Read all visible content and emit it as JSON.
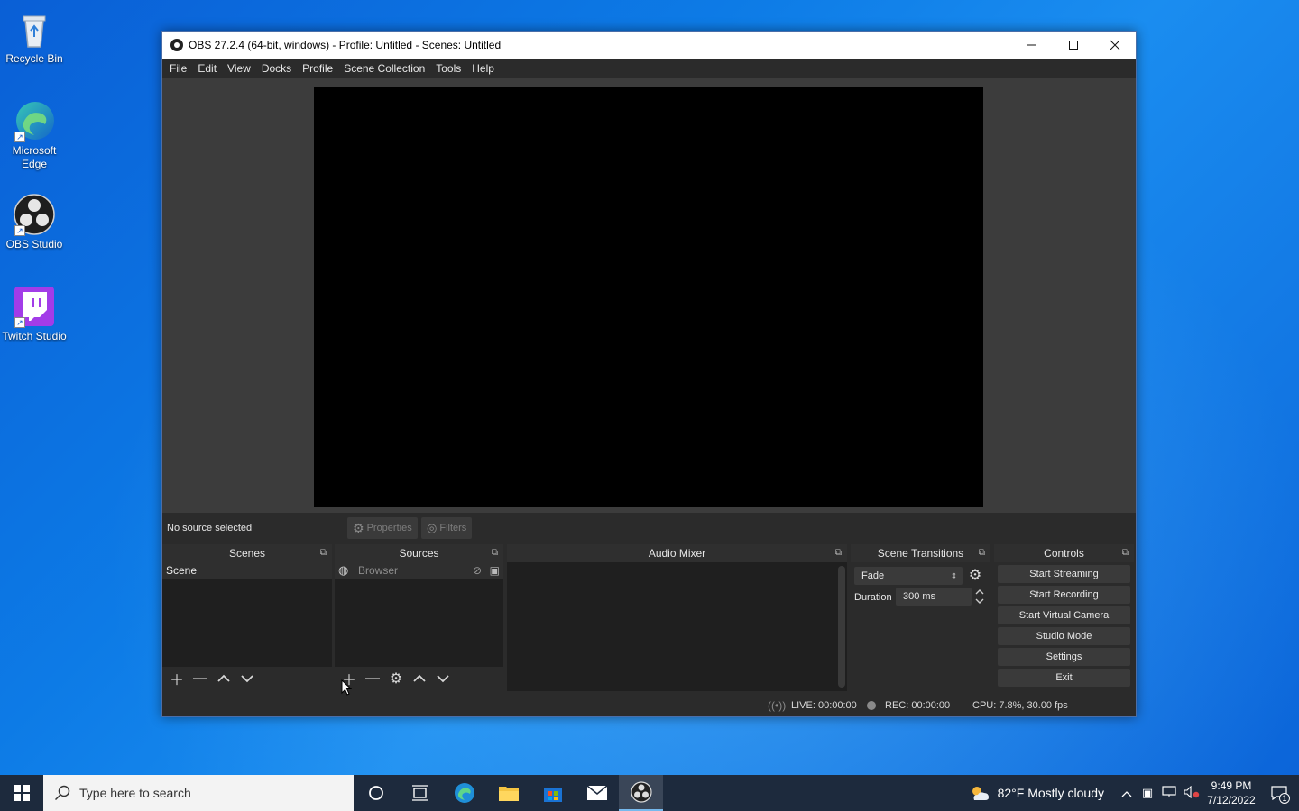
{
  "desktop": {
    "icons": [
      {
        "label": "Recycle Bin"
      },
      {
        "label": "Microsoft Edge"
      },
      {
        "label": "OBS Studio"
      },
      {
        "label": "Twitch Studio"
      }
    ]
  },
  "window": {
    "title": "OBS 27.2.4 (64-bit, windows) - Profile: Untitled - Scenes: Untitled",
    "minimize_icon": "minimize-icon",
    "maximize_icon": "maximize-icon",
    "close_icon": "close-icon"
  },
  "menu": {
    "items": [
      "File",
      "Edit",
      "View",
      "Docks",
      "Profile",
      "Scene Collection",
      "Tools",
      "Help"
    ]
  },
  "source_bar": {
    "no_source": "No source selected",
    "properties": "Properties",
    "filters": "Filters"
  },
  "docks": {
    "scenes": {
      "title": "Scenes",
      "items": [
        "Scene"
      ]
    },
    "sources": {
      "title": "Sources",
      "items": [
        "Browser"
      ]
    },
    "audio_mixer": {
      "title": "Audio Mixer"
    },
    "transitions": {
      "title": "Scene Transitions",
      "selected": "Fade",
      "duration_label": "Duration",
      "duration_value": "300 ms"
    },
    "controls": {
      "title": "Controls",
      "buttons": [
        "Start Streaming",
        "Start Recording",
        "Start Virtual Camera",
        "Studio Mode",
        "Settings",
        "Exit"
      ]
    }
  },
  "status": {
    "live": "LIVE: 00:00:00",
    "rec": "REC: 00:00:00",
    "cpu": "CPU: 7.8%, 30.00 fps"
  },
  "taskbar": {
    "search_placeholder": "Type here to search",
    "weather": "82°F  Mostly cloudy",
    "time": "9:49 PM",
    "date": "7/12/2022",
    "notification_count": "1"
  },
  "colors": {
    "accent": "#76b9ed",
    "obs_background": "#2b2b2b",
    "preview_bg": "#000000"
  }
}
